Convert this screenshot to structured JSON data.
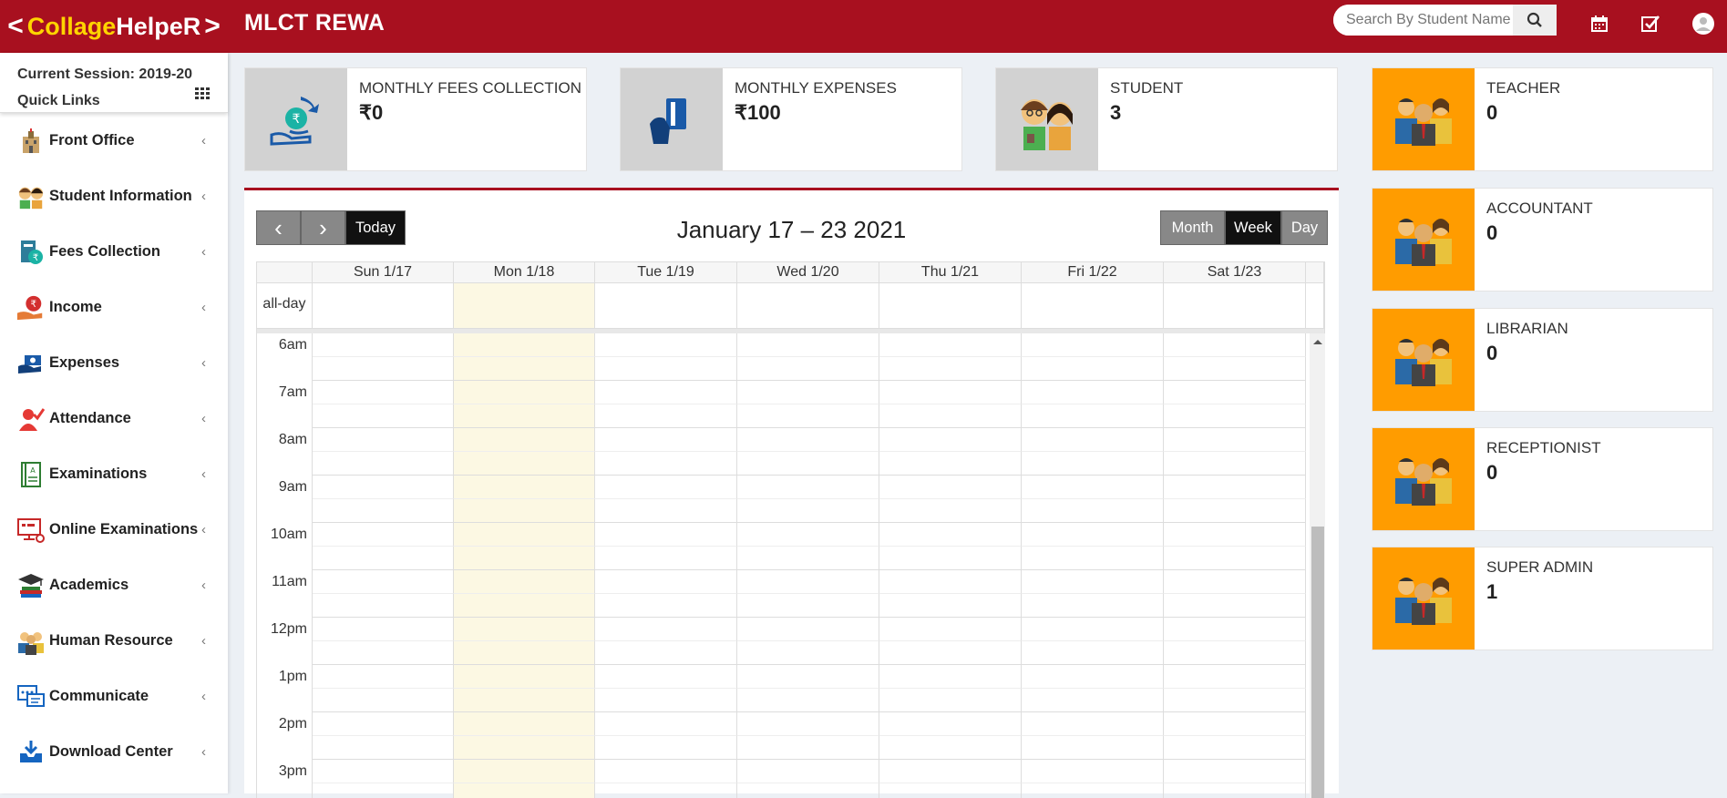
{
  "header": {
    "logo": {
      "left_chev": "<",
      "brand_a": "Collage ",
      "brand_b": "HelpeR",
      "right_chev": ">"
    },
    "title": "MLCT REWA",
    "search_placeholder": "Search By Student Name"
  },
  "sidebar": {
    "session": "Current Session: 2019-20",
    "quick_links": "Quick Links",
    "items": [
      {
        "label": "Front Office",
        "icon": "building-icon"
      },
      {
        "label": "Student Information",
        "icon": "students-icon"
      },
      {
        "label": "Fees Collection",
        "icon": "fees-icon"
      },
      {
        "label": "Income",
        "icon": "rupee-coin-icon"
      },
      {
        "label": "Expenses",
        "icon": "money-hand-icon"
      },
      {
        "label": "Attendance",
        "icon": "attendance-icon"
      },
      {
        "label": "Examinations",
        "icon": "exam-book-icon"
      },
      {
        "label": "Online Examinations",
        "icon": "monitor-icon"
      },
      {
        "label": "Academics",
        "icon": "graduation-cap-icon"
      },
      {
        "label": "Human Resource",
        "icon": "people-icon"
      },
      {
        "label": "Communicate",
        "icon": "chat-icon"
      },
      {
        "label": "Download Center",
        "icon": "download-tray-icon"
      }
    ]
  },
  "cards": [
    {
      "title": "MONTHLY FEES COLLECTION",
      "value": "₹0"
    },
    {
      "title": "MONTHLY EXPENSES",
      "value": "₹100"
    },
    {
      "title": "STUDENT",
      "value": "3"
    }
  ],
  "staff": [
    {
      "title": "TEACHER",
      "value": "0"
    },
    {
      "title": "ACCOUNTANT",
      "value": "0"
    },
    {
      "title": "LIBRARIAN",
      "value": "0"
    },
    {
      "title": "RECEPTIONIST",
      "value": "0"
    },
    {
      "title": "SUPER ADMIN",
      "value": "1"
    }
  ],
  "calendar": {
    "prev": "‹",
    "next": "›",
    "today": "Today",
    "title": "January 17 – 23 2021",
    "views": {
      "month": "Month",
      "week": "Week",
      "day": "Day"
    },
    "all_day": "all-day",
    "days": [
      "Sun 1/17",
      "Mon 1/18",
      "Tue 1/19",
      "Wed 1/20",
      "Thu 1/21",
      "Fri 1/22",
      "Sat 1/23"
    ],
    "times": [
      "6am",
      "7am",
      "8am",
      "9am",
      "10am",
      "11am",
      "12pm",
      "1pm",
      "2pm",
      "3pm"
    ]
  },
  "colors": {
    "primary": "#a8101f",
    "orange": "#ff9c00",
    "today": "#fcf8e3"
  }
}
